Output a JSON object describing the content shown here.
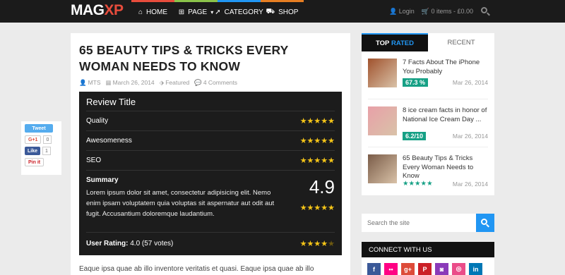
{
  "header": {
    "logo_main": "MAG",
    "logo_accent": "XP",
    "nav": [
      {
        "label": "HOME",
        "icon": "home-icon",
        "glyph": "⌂",
        "color": "#e74c3c"
      },
      {
        "label": "PAGE",
        "icon": "sitemap-icon",
        "glyph": "⊞",
        "color": "#8bc34a"
      },
      {
        "label": "CATEGORY",
        "icon": "rocket-icon",
        "glyph": "➚",
        "color": "#2196f3"
      },
      {
        "label": "SHOP",
        "icon": "cart-icon",
        "glyph": "⛟",
        "color": "#e67e22"
      }
    ],
    "login": "Login",
    "cart": "0 items - £0.00"
  },
  "post": {
    "title": "65 BEAUTY TIPS & TRICKS EVERY WOMAN NEEDS TO KNOW",
    "author": "MTS",
    "date": "March 26, 2014",
    "category": "Featured",
    "comments": "4 Comments",
    "body_start": "Eaque ipsa quae ab illo inventore veritatis et quasi. Eaque ipsa quae ab illo"
  },
  "review": {
    "title": "Review Title",
    "criteria": [
      {
        "label": "Quality",
        "stars": "★★★★★"
      },
      {
        "label": "Awesomeness",
        "stars": "★★★★★"
      },
      {
        "label": "SEO",
        "stars": "★★★★★"
      }
    ],
    "summary_label": "Summary",
    "summary_text": "Lorem ipsum dolor sit amet, consectetur adipisicing elit. Nemo enim ipsam voluptatem quia voluptas sit aspernatur aut odit aut fugit. Accusantium doloremque laudantium.",
    "score": "4.9",
    "score_stars": "★★★★★",
    "user_rating_label": "User Rating:",
    "user_rating_value": "4.0 (57 votes)",
    "user_stars": "★★★★",
    "user_half": "★"
  },
  "share": {
    "tweet": "Tweet",
    "gplus": "G+1",
    "gplus_count": "0",
    "like": "Like",
    "like_count": "1",
    "pin": "Pin it"
  },
  "sidebar": {
    "tab_top_a": "TOP ",
    "tab_top_b": "RATED",
    "tab_recent": "RECENT",
    "items": [
      {
        "title": "7 Facts About The iPhone You Probably",
        "badge": "67.3 %",
        "date": "Mar 26, 2014",
        "thumb": "#a0522d"
      },
      {
        "title": "8 ice cream facts in honor of National Ice Cream Day ...",
        "badge": "6.2/10",
        "date": "Mar 26, 2014",
        "thumb": "#e8a0a8"
      },
      {
        "title": "65 Beauty Tips & Tricks Every Woman Needs to Know",
        "stars": "★★★★★",
        "date": "Mar 26, 2014",
        "thumb": "#7a5c48"
      }
    ],
    "search_placeholder": "Search the site",
    "connect_title": "CONNECT WITH US",
    "socials": [
      {
        "name": "facebook-icon",
        "glyph": "f",
        "color": "#3b5998"
      },
      {
        "name": "flickr-icon",
        "glyph": "••",
        "color": "#ff0084"
      },
      {
        "name": "google-plus-icon",
        "glyph": "g+",
        "color": "#dd4b39"
      },
      {
        "name": "pinterest-icon",
        "glyph": "P",
        "color": "#cb2027"
      },
      {
        "name": "instagram-icon",
        "glyph": "◙",
        "color": "#8a3ab9"
      },
      {
        "name": "dribbble-icon",
        "glyph": "◎",
        "color": "#ea4c89"
      },
      {
        "name": "linkedin-icon",
        "glyph": "in",
        "color": "#0077b5"
      }
    ]
  }
}
